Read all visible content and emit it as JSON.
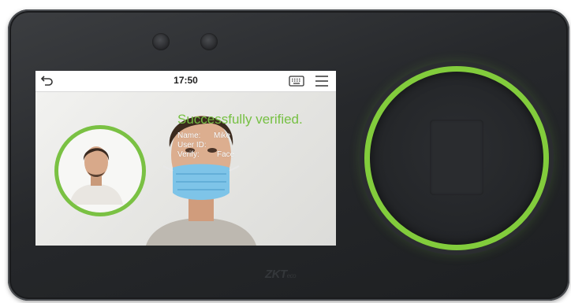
{
  "status_bar": {
    "time": "17:50",
    "icons": [
      "back-arrow-icon",
      "keyboard-icon",
      "menu-icon"
    ]
  },
  "verification": {
    "message": "Successfully verified.",
    "name_label": "Name:",
    "name_value": "Mike",
    "user_id_label": "User ID:",
    "verify_label": "Verify:",
    "verify_value": "Face"
  },
  "device": {
    "brand_logo": "ZKTeco",
    "accent_color": "#7ac143",
    "body_color": "#2a2c2f"
  }
}
